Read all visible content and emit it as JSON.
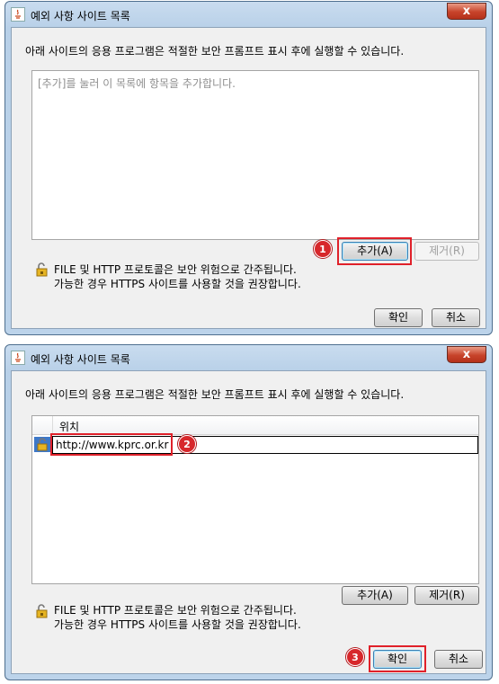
{
  "dialog1": {
    "title": "예외 사항 사이트 목록",
    "close_label": "x",
    "description": "아래 사이트의 응용 프로그램은 적절한 보안 프롬프트 표시 후에 실행할 수 있습니다.",
    "list_placeholder": "[추가]를 눌러 이 목록에 항목을 추가합니다.",
    "add_button": "추가(A)",
    "remove_button": "제거(R)",
    "info_line1": "FILE 및 HTTP 프로토콜은 보안 위험으로 간주됩니다.",
    "info_line2": "가능한 경우 HTTPS 사이트를 사용할 것을 권장합니다.",
    "ok_button": "확인",
    "cancel_button": "취소",
    "step_badge": "1"
  },
  "dialog2": {
    "title": "예외 사항 사이트 목록",
    "close_label": "x",
    "description": "아래 사이트의 응용 프로그램은 적절한 보안 프롬프트 표시 후에 실행할 수 있습니다.",
    "table_header": "위치",
    "rows": [
      {
        "location": "http://www.kprc.or.kr"
      }
    ],
    "add_button": "추가(A)",
    "remove_button": "제거(R)",
    "info_line1": "FILE 및 HTTP 프로토콜은 보안 위험으로 간주됩니다.",
    "info_line2": "가능한 경우 HTTPS 사이트를 사용할 것을 권장합니다.",
    "ok_button": "확인",
    "cancel_button": "취소",
    "step_badge_url": "2",
    "step_badge_ok": "3"
  },
  "colors": {
    "highlight": "#e0212a",
    "badge": "#d7272b",
    "close_button": "#c7432a",
    "title_bar": "#bcd3ea"
  }
}
